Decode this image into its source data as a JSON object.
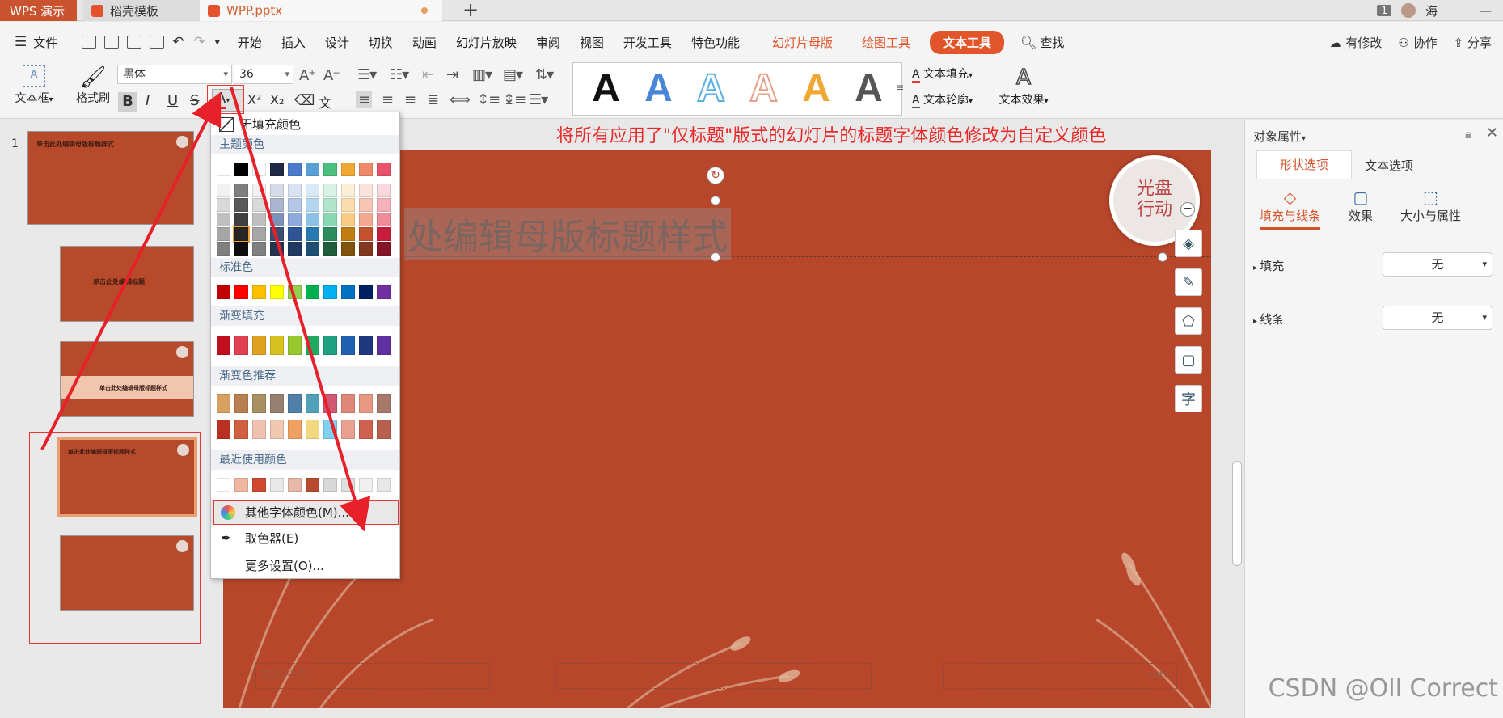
{
  "tabs": {
    "app": "WPS 演示",
    "template": "稻壳模板",
    "file": "WPP.pptx"
  },
  "window": {
    "page_badge": "1",
    "user": "海"
  },
  "menu": {
    "items": [
      "文件",
      "开始",
      "插入",
      "设计",
      "切换",
      "动画",
      "幻灯片放映",
      "审阅",
      "视图",
      "开发工具",
      "特色功能"
    ],
    "context": [
      "幻灯片母版",
      "绘图工具"
    ],
    "active": "文本工具",
    "search": "查找",
    "right": [
      "有修改",
      "协作",
      "分享"
    ]
  },
  "ribbon": {
    "textbox": "文本框",
    "format_painter": "格式刷",
    "font": "黑体",
    "size": "36",
    "text_fill": "文本填充",
    "text_outline": "文本轮廓",
    "text_effect": "文本效果",
    "format_buttons": [
      "B",
      "I",
      "U",
      "S"
    ],
    "styles_colors": [
      "#111111",
      "#4a86d8",
      "#5ab0e0",
      "#e7a08a",
      "#f0a834",
      "#555555"
    ]
  },
  "instruction": "将所有应用了\"仅标题\"版式的幻灯片的标题字体颜色修改为自定义颜色",
  "slide": {
    "title": "单击此处编辑母版标题样式",
    "title_visible": "处编辑母版标题样式",
    "logo": [
      "光盘",
      "行动"
    ],
    "date": "2025-3-23",
    "page": "<#>"
  },
  "thumbs": {
    "numbers": [
      "1"
    ],
    "titles": [
      "单击此处编辑母版标题样式",
      "单击此处编辑标题",
      "单击此处编辑母版标题样式",
      "单击此处编辑母版标题样式",
      ""
    ]
  },
  "dropdown": {
    "no_fill": "无填充颜色",
    "theme_colors": "主题颜色",
    "standard": "标准色",
    "gradient": "渐变填充",
    "gradient_rec": "渐变色推荐",
    "recent": "最近使用颜色",
    "more": "其他字体颜色(M)...",
    "picker": "取色器(E)",
    "settings": "更多设置(O)...",
    "theme_row": [
      "#ffffff",
      "#000000",
      "#ffffff",
      "#1f2a44",
      "#4a7ac9",
      "#5aa0d8",
      "#4cbf7f",
      "#f0a834",
      "#ee8a6a",
      "#e8546a"
    ],
    "theme_cols": [
      [
        "#f2f2f2",
        "#d9d9d9",
        "#bfbfbf",
        "#a6a6a6",
        "#808080"
      ],
      [
        "#7f7f7f",
        "#595959",
        "#404040",
        "#262626",
        "#0d0d0d"
      ],
      [
        "#f2f2f2",
        "#d9d9d9",
        "#bfbfbf",
        "#a6a6a6",
        "#808080"
      ],
      [
        "#d6dbe8",
        "#aab6d0",
        "#7e92b9",
        "#3b4d74",
        "#273352"
      ],
      [
        "#dae3f3",
        "#b4c7e7",
        "#8faadc",
        "#2f5597",
        "#203864"
      ],
      [
        "#d9eaf6",
        "#b3d5ee",
        "#8dc1e5",
        "#2a78b0",
        "#1c5075"
      ],
      [
        "#d8f2e5",
        "#b1e5cb",
        "#8ad8b1",
        "#2d8c5c",
        "#1e5d3d"
      ],
      [
        "#fdeed6",
        "#fbdcae",
        "#f9cb85",
        "#c37c12",
        "#82530c"
      ],
      [
        "#fbe2da",
        "#f7c5b5",
        "#f3a890",
        "#c4522d",
        "#83371e"
      ],
      [
        "#fad8dd",
        "#f5b2bb",
        "#f08b99",
        "#c61e3a",
        "#841427"
      ]
    ],
    "standard_row": [
      "#c00000",
      "#ff0000",
      "#ffc000",
      "#ffff00",
      "#92d050",
      "#00b050",
      "#00b0f0",
      "#0070c0",
      "#002060",
      "#7030a0"
    ],
    "gradient_row": [
      "#c01020",
      "#e04050",
      "#e0a020",
      "#d8c020",
      "#98c830",
      "#20a860",
      "#20a080",
      "#2060b0",
      "#203880",
      "#6030a0"
    ],
    "grad_rec1": [
      "#d8a060",
      "#b88050",
      "#a89060",
      "#988070",
      "#5080a8",
      "#50a0b8",
      "#d05870",
      "#e08878",
      "#e89880",
      "#a87868"
    ],
    "grad_rec2": [
      "#b83020",
      "#d06040",
      "#f0c0b0",
      "#f0c8b0",
      "#f0a060",
      "#f0d880",
      "#80d0f0",
      "#e8a090",
      "#d06050",
      "#b86050"
    ],
    "recent_row": [
      "#ffffff",
      "#f0b8a0",
      "#d04a30",
      "#e8e8e8",
      "#e8b8a8",
      "#b84a30",
      "#d8d8d8",
      "#e0e0e0",
      "#f0f0f0",
      "#e8e8e8"
    ]
  },
  "panel": {
    "title": "对象属性",
    "tabs": [
      "形状选项",
      "文本选项"
    ],
    "sub": [
      "填充与线条",
      "效果",
      "大小与属性"
    ],
    "fill_label": "填充",
    "fill_val": "无",
    "line_label": "线条",
    "line_val": "无"
  },
  "watermark": "CSDN @Oll Correct"
}
